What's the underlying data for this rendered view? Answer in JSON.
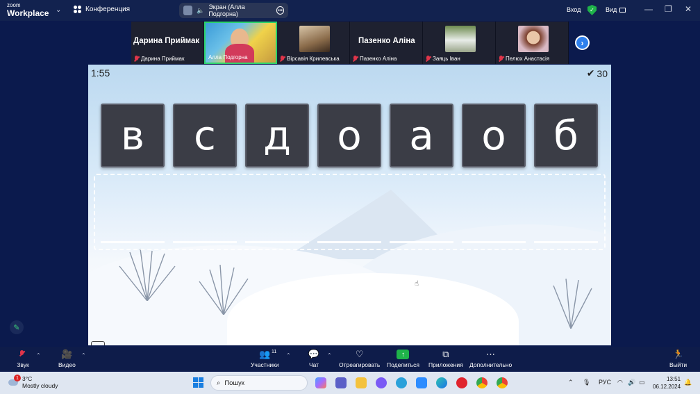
{
  "zoom": {
    "logo_line1": "zoom",
    "logo_line2": "Workplace",
    "conference_label": "Конференция",
    "screen_share_label": "Экран (Алла Подгорна)",
    "signin_label": "Вход",
    "view_label": "Вид"
  },
  "participants": {
    "tiles": [
      {
        "big_name": "Дарина Приймак",
        "label": "Дарина Приймак"
      },
      {
        "big_name": "",
        "label": "Алла Подгорна"
      },
      {
        "big_name": "",
        "label": "Вірсавія Крилевська"
      },
      {
        "big_name": "Пазенко Аліна",
        "label": "Пазенко Аліна"
      },
      {
        "big_name": "",
        "label": "Заяць Іван"
      },
      {
        "big_name": "",
        "label": "Пелюх Анастасія"
      }
    ]
  },
  "game": {
    "timer": "1:55",
    "score": "30",
    "letters": [
      "в",
      "с",
      "д",
      "о",
      "а",
      "о",
      "б"
    ]
  },
  "toolbar": {
    "audio_label": "Звук",
    "video_label": "Видео",
    "participants_label": "Участники",
    "participants_count": "11",
    "chat_label": "Чат",
    "react_label": "Отреагировать",
    "share_label": "Поделиться",
    "apps_label": "Приложения",
    "more_label": "Дополнительно",
    "leave_label": "Выйти"
  },
  "taskbar": {
    "temperature": "3°C",
    "weather_text": "Mostly cloudy",
    "weather_badge": "1",
    "search_placeholder": "Пошук",
    "language": "РУС",
    "time": "13:51",
    "date": "06.12.2024"
  }
}
